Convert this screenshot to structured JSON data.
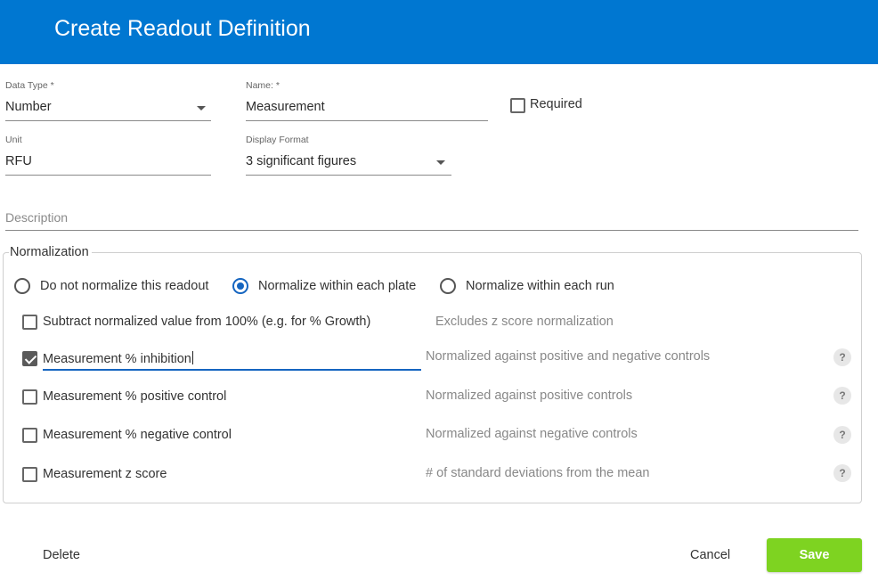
{
  "header": {
    "title": "Create Readout Definition"
  },
  "colors": {
    "header_bg": "#0077d1",
    "accent": "#1565c0",
    "save_bg": "#7ed321"
  },
  "form": {
    "data_type": {
      "label": "Data Type *",
      "value": "Number"
    },
    "name": {
      "label": "Name: *",
      "value": "Measurement"
    },
    "required": {
      "label": "Required",
      "checked": false
    },
    "unit": {
      "label": "Unit",
      "value": "RFU"
    },
    "display_format": {
      "label": "Display Format",
      "value": "3 significant figures"
    },
    "description": {
      "placeholder": "Description",
      "value": ""
    }
  },
  "normalization": {
    "legend": "Normalization",
    "radios": [
      {
        "label": "Do not normalize this readout",
        "selected": false
      },
      {
        "label": "Normalize within each plate",
        "selected": true
      },
      {
        "label": "Normalize within each run",
        "selected": false
      }
    ],
    "subtract": {
      "label": "Subtract normalized value from 100% (e.g. for % Growth)",
      "checked": false,
      "hint": "Excludes z score normalization"
    },
    "outputs": [
      {
        "label": "Measurement % inhibition",
        "checked": true,
        "hint": "Normalized against positive and negative controls",
        "help": "?"
      },
      {
        "label": "Measurement % positive control",
        "checked": false,
        "hint": "Normalized against positive controls",
        "help": "?"
      },
      {
        "label": "Measurement % negative control",
        "checked": false,
        "hint": "Normalized against negative controls",
        "help": "?"
      },
      {
        "label": "Measurement z score",
        "checked": false,
        "hint": "# of standard deviations from the mean",
        "help": "?"
      }
    ]
  },
  "footer": {
    "delete_label": "Delete",
    "cancel_label": "Cancel",
    "save_label": "Save"
  }
}
